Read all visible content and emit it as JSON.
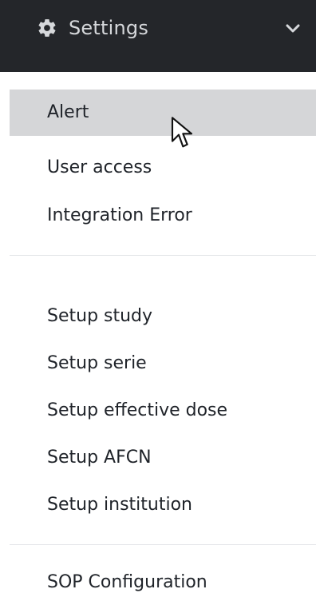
{
  "header": {
    "settings_label": "Settings",
    "icons": {
      "settings": "gear-icon",
      "toggle": "chevron-down-icon"
    },
    "colors": {
      "bar_bg": "#24262a",
      "text": "#d6d8db"
    }
  },
  "menu": {
    "groups": [
      {
        "items": [
          {
            "label": "Alert",
            "active": true
          },
          {
            "label": "User access",
            "active": false
          },
          {
            "label": "Integration Error",
            "active": false
          }
        ]
      },
      {
        "items": [
          {
            "label": "Setup study",
            "active": false
          },
          {
            "label": "Setup serie",
            "active": false
          },
          {
            "label": "Setup effective dose",
            "active": false
          },
          {
            "label": "Setup AFCN",
            "active": false
          },
          {
            "label": "Setup institution",
            "active": false
          }
        ]
      },
      {
        "items": [
          {
            "label": "SOP Configuration",
            "active": false
          }
        ]
      }
    ],
    "colors": {
      "active_bg": "#d5d6d8",
      "text": "#1f2329"
    }
  }
}
